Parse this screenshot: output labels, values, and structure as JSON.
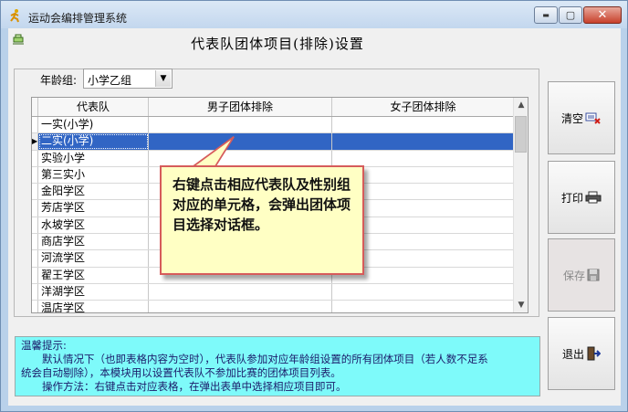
{
  "window": {
    "title": "运动会编排管理系统",
    "controls": {
      "minimize": "▬",
      "maximize": "▢",
      "close": "✕"
    }
  },
  "heading": "代表队团体项目(排除)设置",
  "age_group": {
    "label": "年龄组:",
    "selected": "小学乙组"
  },
  "grid": {
    "columns": [
      "代表队",
      "男子团体排除",
      "女子团体排除"
    ],
    "rows": [
      {
        "team": "一实(小学)",
        "male": "",
        "female": ""
      },
      {
        "team": "二实(小学)",
        "male": "",
        "female": "",
        "selected": true
      },
      {
        "team": "实验小学",
        "male": "",
        "female": ""
      },
      {
        "team": "第三实小",
        "male": "",
        "female": ""
      },
      {
        "team": "金阳学区",
        "male": "",
        "female": ""
      },
      {
        "team": "芳店学区",
        "male": "",
        "female": ""
      },
      {
        "team": "水坡学区",
        "male": "",
        "female": ""
      },
      {
        "team": "商店学区",
        "male": "",
        "female": ""
      },
      {
        "team": "河流学区",
        "male": "",
        "female": ""
      },
      {
        "team": "翟王学区",
        "male": "",
        "female": ""
      },
      {
        "team": "洋湖学区",
        "male": "",
        "female": ""
      },
      {
        "team": "温店学区",
        "male": "",
        "female": ""
      }
    ]
  },
  "callout": "右键点击相应代表队及性别组对应的单元格，会弹出团体项目选择对话框。",
  "buttons": {
    "clear": "清空",
    "print": "打印",
    "save": "保存",
    "exit": "退出"
  },
  "tips": {
    "title": "温馨提示:",
    "line1": "默认情况下（也即表格内容为空时），代表队参加对应年龄组设置的所有团体项目（若人数不足系",
    "line2": "统会自动剔除），本模块用以设置代表队不参加比赛的团体项目列表。",
    "line3": "操作方法：右键点击对应表格，在弹出表单中选择相应项目即可。"
  },
  "colors": {
    "selection": "#3165c4",
    "tips_bg": "#7efafa",
    "callout_bg": "#ffffc4",
    "callout_border": "#d65b5b"
  }
}
